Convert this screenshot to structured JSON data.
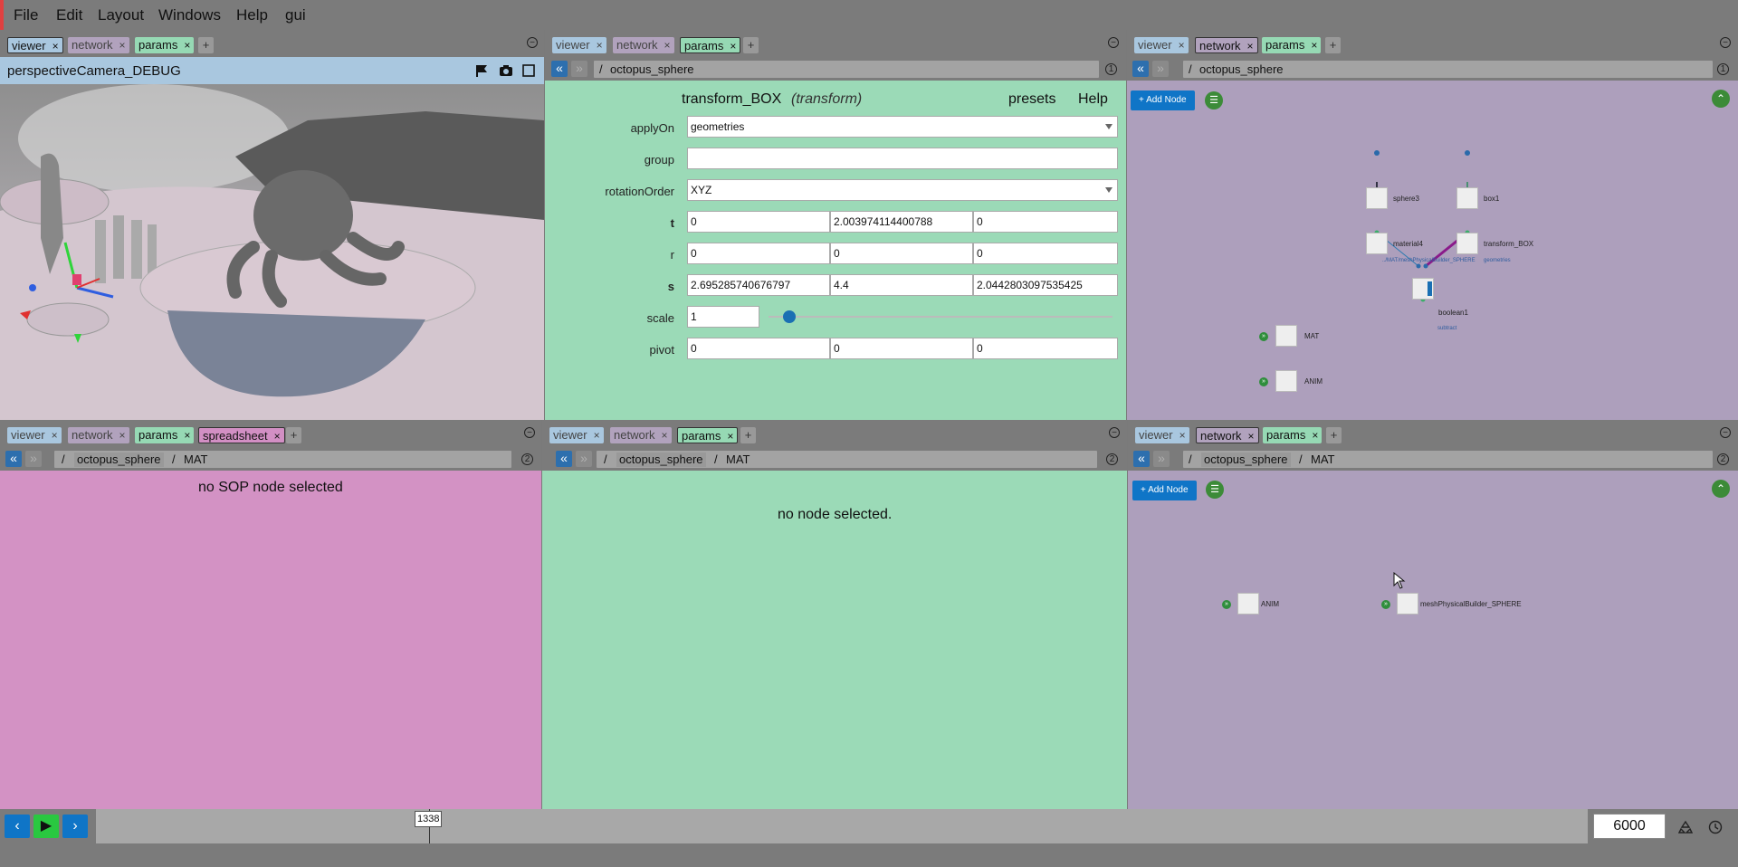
{
  "menu": [
    "File",
    "Edit",
    "Layout",
    "Windows",
    "Help",
    "gui"
  ],
  "tabs": {
    "viewer": "viewer",
    "network": "network",
    "params": "params",
    "spreadsheet": "spreadsheet",
    "plus": "+",
    "close": "×"
  },
  "panel_numbers": {
    "one": "1",
    "two": "2"
  },
  "viewer_panel": {
    "camera_title": "perspectiveCamera_DEBUG"
  },
  "params_panel": {
    "path_root": "/",
    "path_node": "octopus_sphere",
    "node_name": "transform_BOX",
    "node_type": "(transform)",
    "presets": "presets",
    "help": "Help",
    "params": {
      "applyOn": {
        "label": "applyOn",
        "value": "geometries"
      },
      "group": {
        "label": "group",
        "value": ""
      },
      "rotationOrder": {
        "label": "rotationOrder",
        "value": "XYZ"
      },
      "t": {
        "label": "t",
        "x": "0",
        "y": "2.003974114400788",
        "z": "0"
      },
      "r": {
        "label": "r",
        "x": "0",
        "y": "0",
        "z": "0"
      },
      "s": {
        "label": "s",
        "x": "2.695285740676797",
        "y": "4.4",
        "z": "2.0442803097535425"
      },
      "scale": {
        "label": "scale",
        "value": "1",
        "slider_fraction": 0.06
      },
      "pivot": {
        "label": "pivot",
        "x": "0",
        "y": "0",
        "z": "0"
      }
    }
  },
  "network_top": {
    "path_root": "/",
    "path_node": "octopus_sphere",
    "add_node": "+ Add Node",
    "nodes": {
      "sphere3": "sphere3",
      "box1": "box1",
      "material4": "material4",
      "transform_BOX": "transform_BOX",
      "boolean1": "boolean1",
      "MAT": "MAT",
      "ANIM": "ANIM",
      "material_path": "../MAT/meshPhysicalBuilder_SPHERE",
      "geometries": "geometries",
      "subtract": "subtract"
    }
  },
  "spreadsheet_panel": {
    "path_root": "/",
    "path_node": "octopus_sphere",
    "sep": "/",
    "path_child": "MAT",
    "message": "no SOP node selected"
  },
  "params_bottom": {
    "path_root": "/",
    "path_node": "octopus_sphere",
    "sep": "/",
    "path_child": "MAT",
    "message": "no node selected."
  },
  "network_bottom": {
    "path_root": "/",
    "path_node": "octopus_sphere",
    "sep": "/",
    "path_child": "MAT",
    "add_node": "+ Add Node",
    "nodes": {
      "ANIM": "ANIM",
      "meshPhysicalBuilder_SPHERE": "meshPhysicalBuilder_SPHERE"
    }
  },
  "timeline": {
    "current_frame": "1338",
    "current_fraction": 0.223,
    "end_frame": "6000"
  },
  "colors": {
    "viewer": "#a9c7df",
    "network": "#ad9fbc",
    "params": "#9bdab7",
    "spreadsheet": "#d392c4",
    "accent": "#0f75c7",
    "play": "#29c840"
  }
}
